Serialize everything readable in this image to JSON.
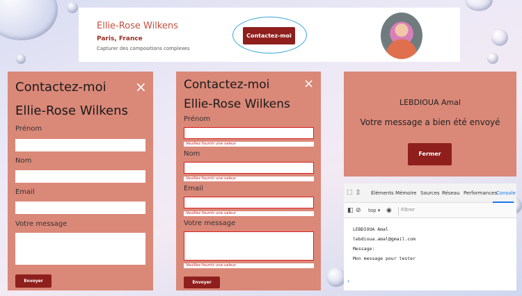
{
  "header": {
    "name": "Ellie-Rose Wilkens",
    "location": "Paris, France",
    "tagline": "Capturer des compositions complexes",
    "contact_button": "Contactez-moi"
  },
  "form1": {
    "title": "Contactez-moi",
    "subtitle": "Ellie-Rose Wilkens",
    "close": "×",
    "fields": [
      {
        "label": "Prénom",
        "value": ""
      },
      {
        "label": "Nom",
        "value": ""
      },
      {
        "label": "Email",
        "value": ""
      },
      {
        "label": "Votre message",
        "value": ""
      }
    ],
    "submit": "Envoyer"
  },
  "form2": {
    "title": "Contactez-moi",
    "subtitle": "Ellie-Rose Wilkens",
    "close": "×",
    "fields": [
      {
        "label": "Prénom",
        "error": "Veuillez fournir une valeur"
      },
      {
        "label": "Nom",
        "error": "Veuillez fournir une valeur"
      },
      {
        "label": "Email",
        "error": "Veuillez fournir une valeur"
      },
      {
        "label": "Votre message",
        "error": "Veuillez fournir une valeur"
      }
    ],
    "submit": "Envoyer"
  },
  "confirmation": {
    "name": "LEBDIOUA Amal",
    "message": "Votre message a bien été envoyé",
    "close_button": "Fermer"
  },
  "devtools": {
    "tabs": [
      "Éléments",
      "Mémoire",
      "Sources",
      "Réseau",
      "Performances",
      "Console"
    ],
    "active_tab": "Console",
    "context": "top ▾",
    "filter_placeholder": "Filtrer",
    "log": [
      "LEBDIOUA  Amal",
      "lebdioua.amal@gmail.com",
      "Message:",
      "Mon message pour tester"
    ],
    "prompt": "›"
  }
}
